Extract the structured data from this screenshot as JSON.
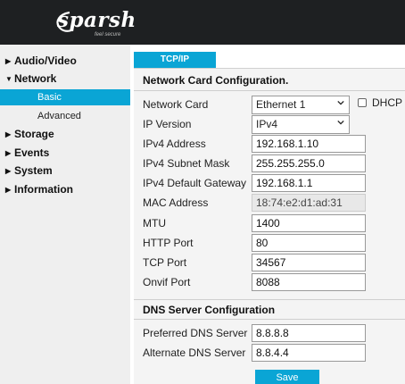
{
  "logo": {
    "brand": "sparsh",
    "tagline": "feel secure"
  },
  "sidebar": {
    "items": [
      {
        "label": "Audio/Video",
        "expanded": false
      },
      {
        "label": "Network",
        "expanded": true
      },
      {
        "label": "Storage",
        "expanded": false
      },
      {
        "label": "Events",
        "expanded": false
      },
      {
        "label": "System",
        "expanded": false
      },
      {
        "label": "Information",
        "expanded": false
      }
    ],
    "network_sub": [
      {
        "label": "Basic",
        "active": true
      },
      {
        "label": "Advanced",
        "active": false
      }
    ]
  },
  "tab": {
    "label": "TCP/IP"
  },
  "card_section": {
    "title": "Network Card Configuration.",
    "network_card": {
      "label": "Network Card",
      "value": "Ethernet 1"
    },
    "dhcp": {
      "label": "DHCP",
      "checked": false
    },
    "ip_version": {
      "label": "IP Version",
      "value": "IPv4"
    },
    "ipv4_address": {
      "label": "IPv4 Address",
      "value": "192.168.1.10"
    },
    "subnet_mask": {
      "label": "IPv4 Subnet Mask",
      "value": "255.255.255.0"
    },
    "gateway": {
      "label": "IPv4 Default Gateway",
      "value": "192.168.1.1"
    },
    "mac": {
      "label": "MAC Address",
      "value": "18:74:e2:d1:ad:31"
    },
    "mtu": {
      "label": "MTU",
      "value": "1400"
    },
    "http_port": {
      "label": "HTTP Port",
      "value": "80"
    },
    "tcp_port": {
      "label": "TCP Port",
      "value": "34567"
    },
    "onvif_port": {
      "label": "Onvif Port",
      "value": "8088"
    }
  },
  "dns_section": {
    "title": "DNS Server Configuration",
    "preferred": {
      "label": "Preferred DNS Server",
      "value": "8.8.8.8"
    },
    "alternate": {
      "label": "Alternate DNS Server",
      "value": "8.8.4.4"
    }
  },
  "save_label": "Save",
  "colors": {
    "accent": "#0aa5d5",
    "header_bg": "#1e2022",
    "sidebar_bg": "#efefef",
    "content_bg": "#f4f4f4"
  }
}
